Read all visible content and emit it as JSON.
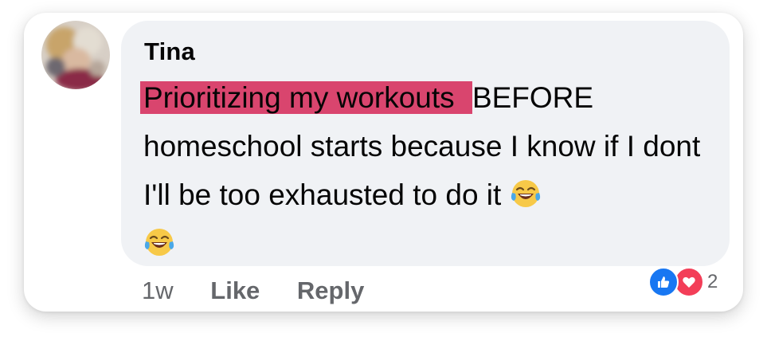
{
  "comment": {
    "author": "Tina",
    "highlighted_text": "Prioritizing my workouts ",
    "text_rest": "BEFORE homeschool starts because I know if I dont I'll be too exhausted to do it",
    "emojis": [
      "laughing-tears-emoji",
      "laughing-tears-emoji"
    ],
    "timestamp": "1w",
    "like_label": "Like",
    "reply_label": "Reply",
    "reaction_count": "2",
    "reaction_icons": [
      "like-icon",
      "love-icon"
    ]
  },
  "colors": {
    "highlight": "#d9456e",
    "bubble": "#f0f2f5",
    "meta_text": "#65676b",
    "like_blue": "#1877f2",
    "love_red": "#f33e58"
  }
}
